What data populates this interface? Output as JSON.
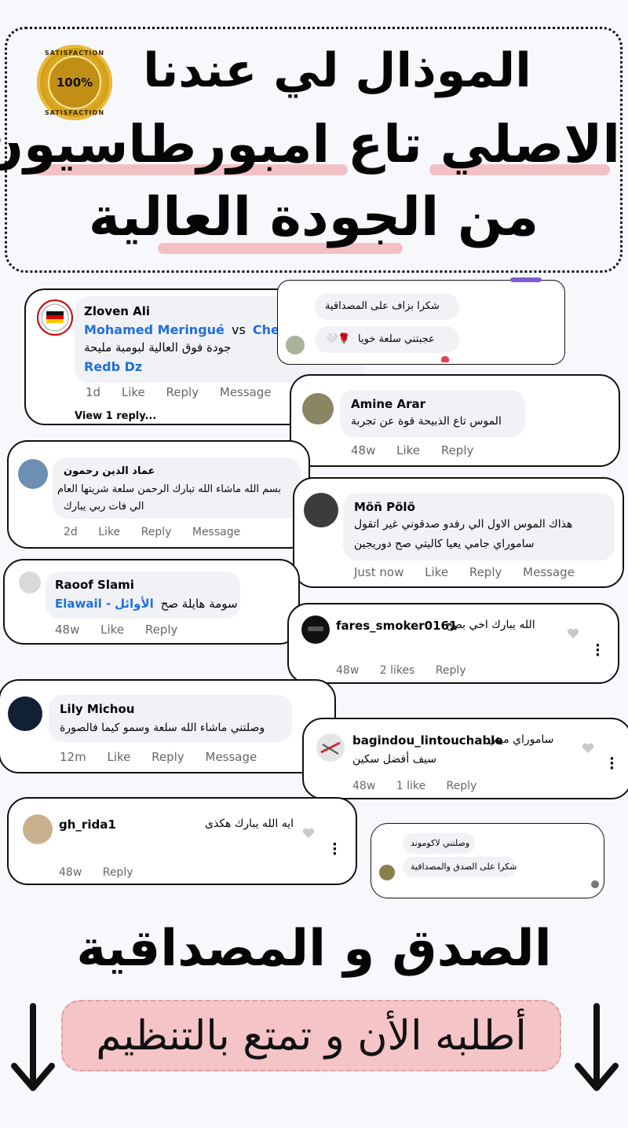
{
  "headline": {
    "line1": "الموذال لي عندنا",
    "line2": "الاصلي تاع امبورطاسيون",
    "line3": "من الجودة العالية",
    "seal_text": "100%",
    "seal_arc_top": "SATISFACTION",
    "seal_arc_bottom": "SATISFACTION"
  },
  "comments": {
    "c1": {
      "name": "Zloven Ali",
      "mention1": "Mohamed Meringué",
      "vs": "vs",
      "mention2": "Chemse",
      "text": "جودة فوق العالية لبومبة مليحة",
      "mention3": "Redb Dz",
      "time": "1d",
      "like": "Like",
      "reply": "Reply",
      "message": "Message",
      "view_replies": "View 1 reply..."
    },
    "c2": {
      "line1": "شكرا بزاف على المصداقية",
      "line2": "عجبتني سلعة خويا",
      "emoji": "🤍🌹"
    },
    "c3": {
      "name": "Amine Arar",
      "text": "الموس تاع الذبيحة قوة عن تجربة",
      "time": "48w",
      "like": "Like",
      "reply": "Reply"
    },
    "c4": {
      "name": "عماد الدين رحمون",
      "line1": "بسم الله ماشاء الله تبارك الرحمن سلعة شريتها العام",
      "line2": "الي فات ربي يبارك",
      "time": "2d",
      "like": "Like",
      "reply": "Reply",
      "message": "Message"
    },
    "c5": {
      "name": "Möñ Pölö",
      "line1": "هذاك الموس الاول الي رفدو صدقوني غير اتقول",
      "line2": "ساموراي جامي يعيا كاليتي صح دوريجين",
      "time": "Just now",
      "like": "Like",
      "reply": "Reply",
      "message": "Message"
    },
    "c6": {
      "name": "Raoof Slami",
      "link": "Elawail -",
      "text_link": "الأوائل",
      "text": "سومة هايلة صح",
      "time": "48w",
      "like": "Like",
      "reply": "Reply"
    },
    "c7": {
      "name": "fares_smoker0161",
      "text": "الله يبارك اخي بصح",
      "time": "48w",
      "likes": "2 likes",
      "reply": "Reply"
    },
    "c8": {
      "name": "Lily Michou",
      "text": "وصلتني ماشاء الله سلعة وسمو كيما فالصورة",
      "time": "12m",
      "like": "Like",
      "reply": "Reply",
      "message": "Message"
    },
    "c9": {
      "name": "bagindou_lintouchable",
      "line1": "ساموراي ميني",
      "line2": "سيف أفضل سكين",
      "time": "48w",
      "likes": "1 like",
      "reply": "Reply"
    },
    "c10": {
      "name": "gh_rida1",
      "text": "ايه الله يبارك هكذى",
      "time": "48w",
      "reply": "Reply"
    },
    "c11": {
      "line1": "وصلتني لاكوموند",
      "line2": "شكرا على الصدق والمصداقية"
    }
  },
  "footer": {
    "title": "الصدق و المصداقية",
    "cta": "أطلبه الأن و تمتع بالتنظيم"
  },
  "colors": {
    "link": "#216fdb",
    "highlight": "#f3c1c5",
    "cta_bg": "#f5c4c6",
    "bubble": "#f0f2f5"
  }
}
